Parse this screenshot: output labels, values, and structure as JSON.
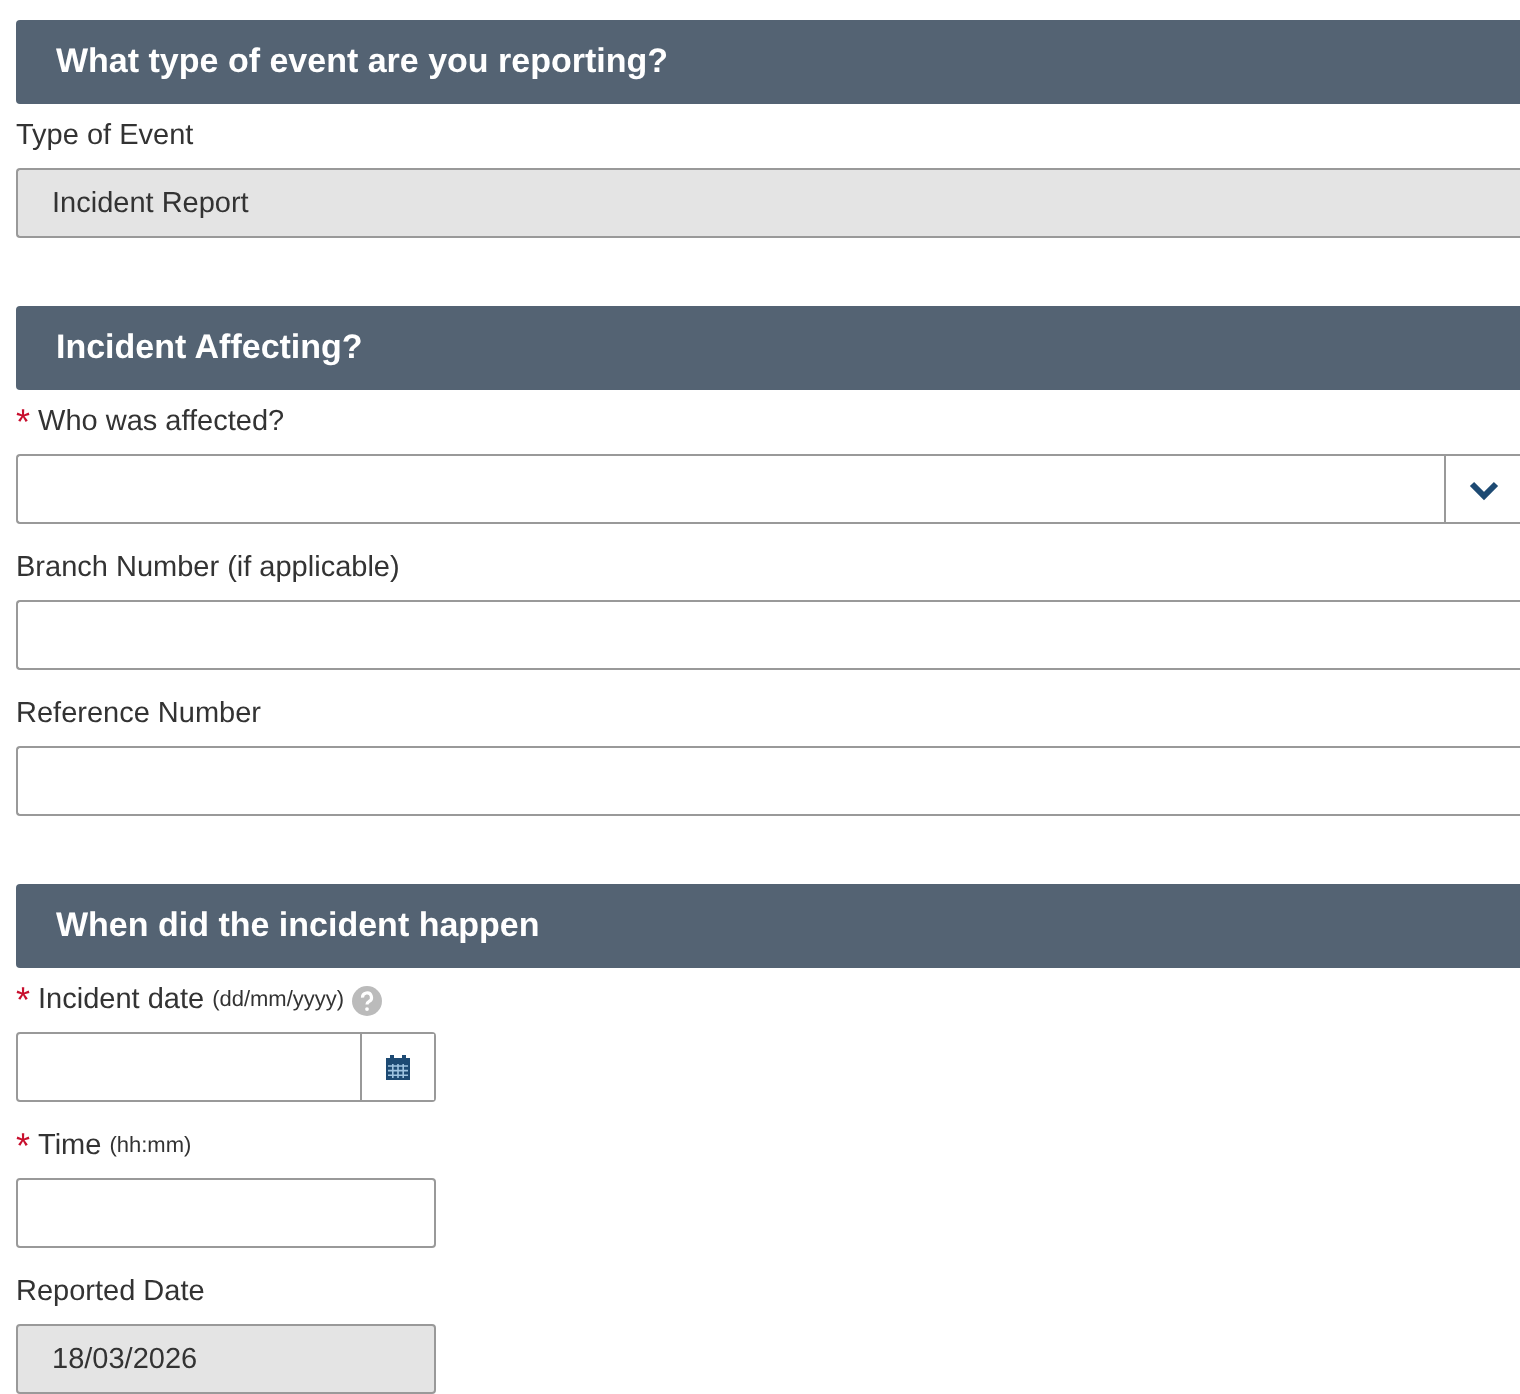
{
  "sections": [
    {
      "title": "What type of event are you reporting?",
      "fields": [
        {
          "kind": "readonly",
          "wide": true,
          "label": "Type of Event",
          "value": "Incident Report"
        }
      ]
    },
    {
      "title": "Incident Affecting?",
      "fields": [
        {
          "kind": "dropdown",
          "wide": true,
          "required_mark": "*",
          "label": "Who was affected?"
        },
        {
          "kind": "text",
          "wide": true,
          "label": "Branch Number (if applicable)"
        },
        {
          "kind": "text",
          "wide": true,
          "label": "Reference Number"
        }
      ]
    },
    {
      "title": "When did the incident happen",
      "fields": [
        {
          "kind": "date",
          "wide": false,
          "required_mark": "*",
          "label": "Incident date",
          "hint": "(dd/mm/yyyy)",
          "help": true
        },
        {
          "kind": "text",
          "wide": false,
          "required_mark": "*",
          "label": "Time",
          "hint": "(hh:mm)"
        },
        {
          "kind": "readonly",
          "wide": false,
          "label": "Reported Date",
          "value": "18/03/2026"
        }
      ]
    }
  ]
}
